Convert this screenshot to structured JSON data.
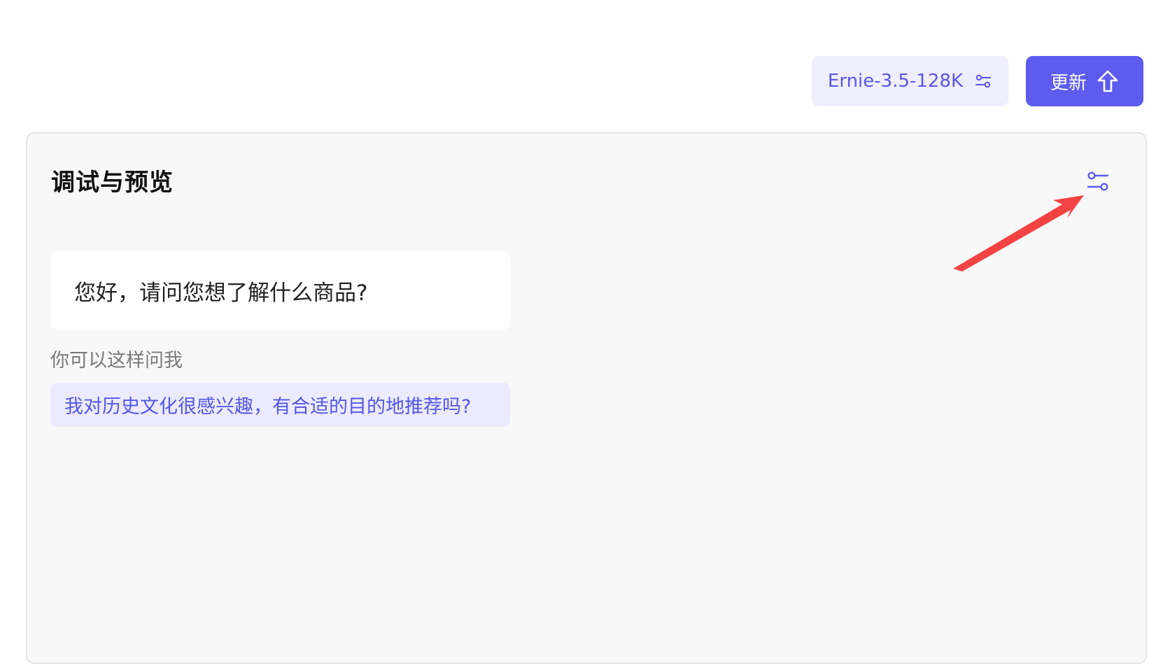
{
  "header": {
    "model_label": "Ernie-3.5-128K",
    "update_label": "更新",
    "model_icon": "sliders-icon",
    "update_icon": "arrow-up-icon"
  },
  "panel": {
    "title": "调试与预览",
    "settings_icon": "sliders-icon",
    "welcome_message": "您好，请问您想了解什么商品?",
    "suggestion_label": "你可以这样问我",
    "suggestions": [
      "我对历史文化很感兴趣，有合适的目的地推荐吗?"
    ]
  },
  "colors": {
    "accent": "#5d5cef",
    "accent_soft": "#efeefe",
    "panel_background": "#f8f8f9",
    "annotation": "#f44343"
  }
}
